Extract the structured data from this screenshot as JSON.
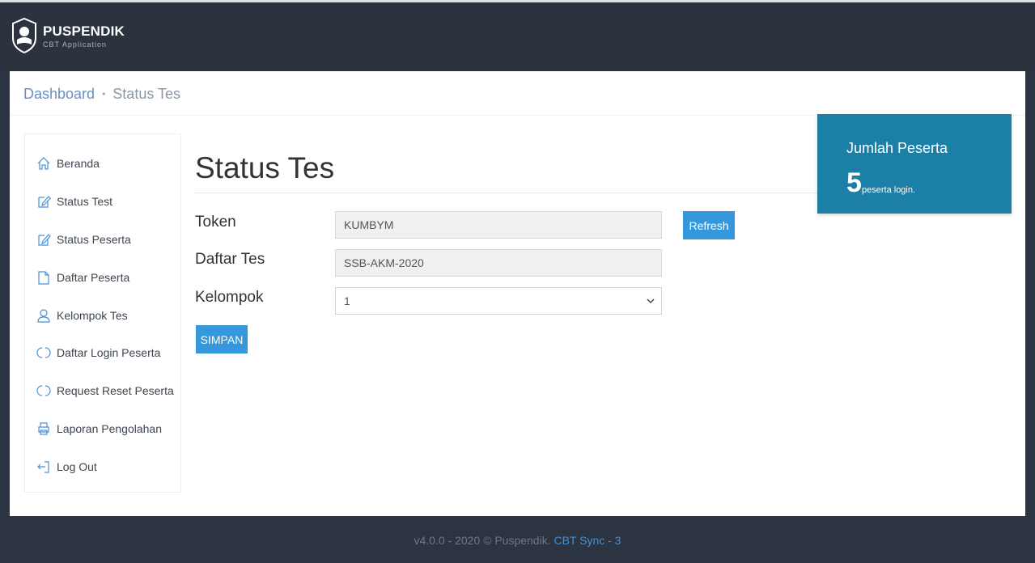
{
  "header": {
    "brand": "PUSPENDIK",
    "subtitle": "CBT Application"
  },
  "breadcrumb": {
    "home": "Dashboard",
    "separator": "•",
    "current": "Status Tes"
  },
  "sidebar": {
    "items": [
      {
        "label": "Beranda",
        "icon": "home-icon"
      },
      {
        "label": "Status Test",
        "icon": "edit-icon"
      },
      {
        "label": "Status Peserta",
        "icon": "edit-icon"
      },
      {
        "label": "Daftar Peserta",
        "icon": "document-icon"
      },
      {
        "label": "Kelompok Tes",
        "icon": "user-icon"
      },
      {
        "label": "Daftar Login Peserta",
        "icon": "refresh-icon"
      },
      {
        "label": "Request Reset Peserta",
        "icon": "refresh-icon"
      },
      {
        "label": "Laporan Pengolahan",
        "icon": "printer-icon"
      },
      {
        "label": "Log Out",
        "icon": "logout-icon"
      }
    ]
  },
  "main": {
    "title": "Status Tes",
    "token_label": "Token",
    "token_value": "KUMBYM",
    "refresh_label": "Refresh",
    "daftar_label": "Daftar Tes",
    "daftar_value": "SSB-AKM-2020",
    "kelompok_label": "Kelompok",
    "kelompok_value": "1",
    "save_label": "SIMPAN"
  },
  "stats": {
    "title": "Jumlah Peserta",
    "count": "5",
    "unit": "peserta login."
  },
  "footer": {
    "text": "v4.0.0 - 2020 © Puspendik.",
    "link": "CBT Sync - 3"
  },
  "colors": {
    "accent": "#3598dc",
    "card": "#1b7fa7",
    "header": "#2b333e"
  }
}
